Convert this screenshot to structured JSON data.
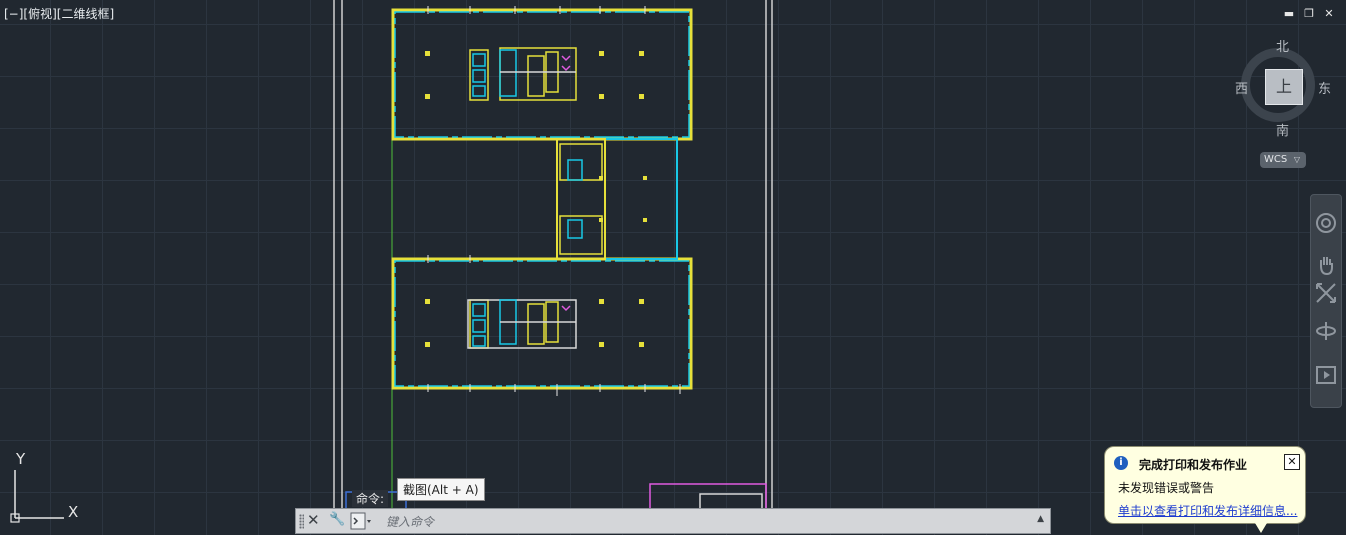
{
  "viewport": {
    "label": "[−][俯视][二维线框]"
  },
  "window_controls": {
    "minimize": "▬",
    "restore": "❐",
    "close": "✕"
  },
  "viewcube": {
    "north": "北",
    "south": "南",
    "west": "西",
    "east": "东",
    "face": "上",
    "wcs_label": "WCS"
  },
  "navbar": {
    "tools": [
      "steering-wheel-icon",
      "pan-hand-icon",
      "zoom-extents-icon",
      "orbit-icon",
      "showmotion-icon"
    ]
  },
  "ucs": {
    "y_label": "Y",
    "x_label": "X"
  },
  "command": {
    "history_prompt": "命令:",
    "input_placeholder": "键入命令",
    "tooltip": "截图(Alt + A)"
  },
  "notification": {
    "title": "完成打印和发布作业",
    "message": "未发现错误或警告",
    "link": "单击以查看打印和发布详细信息..."
  },
  "colors": {
    "background": "#212830",
    "grid": "#2c3540",
    "cad_yellow": "#e6e03a",
    "cad_cyan": "#19c8e6",
    "cad_white": "#e6e6e6",
    "cad_magenta": "#e05ae0",
    "cad_green": "#4fbf3a",
    "balloon": "#ffffe1"
  }
}
